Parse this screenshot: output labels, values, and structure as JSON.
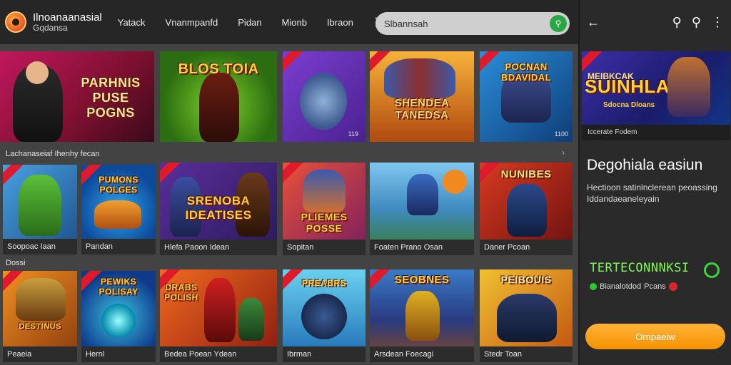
{
  "header": {
    "brand_title": "Ilnoanaanasial",
    "brand_subtitle": "Gqdansa",
    "nav": [
      "Yatack",
      "Vnanmpanfd",
      "Pidan",
      "Mionb",
      "Ibraon"
    ],
    "search_value": "Slbannsah"
  },
  "row1": [
    {
      "title": "PARHNIS\nPUSE POGNS"
    },
    {
      "title": "BLOS  TOIA"
    },
    {
      "title": "",
      "badge": "119"
    },
    {
      "title": "SHENDEA\nTANEDSA"
    },
    {
      "title": "POCNAN\nBDAVIDAL",
      "badge": "1100"
    }
  ],
  "section1_label": "Lachanaseiaf Ihenhy fecan",
  "row2": [
    {
      "title": "",
      "caption": "Soopoac Iaan"
    },
    {
      "title": "PUMONS\nPOLGES",
      "caption": "Pandan"
    },
    {
      "title": "SRENOBA\nIDEATISES",
      "caption": "Hlefa Paoon Idean"
    },
    {
      "title": "PLIEMES\nPOSSE",
      "caption": "Sopitan"
    },
    {
      "title": "",
      "caption": "Foaten Prano Osan"
    },
    {
      "title": "NUNIBES",
      "caption": "Daner Pcoan"
    }
  ],
  "section2_label": "Dossi",
  "row3": [
    {
      "title": "DESTINUS",
      "caption": "Peaeia"
    },
    {
      "title": "PEWIKS\nPOLISAY",
      "caption": "Hernl"
    },
    {
      "title": "DRABS\nPOLISH",
      "caption": "Bedea Poean Ydean"
    },
    {
      "title": "PREABRS",
      "caption": "Ibrman"
    },
    {
      "title": "SEOBNES",
      "caption": "Arsdean Foecagi"
    },
    {
      "title": "PEIBOUIS",
      "caption": "Stedr Toan"
    }
  ],
  "panel": {
    "feature_sub": "MEIBKCAK",
    "feature_title": "SUINHLAS",
    "feature_tag": "Sdocna Dloans",
    "feature_caption": "Iccerate Fodem",
    "title": "Degohiala easiun",
    "description": "Hectioon satinlnclerean peoassing Iddandaeaneleyain",
    "green_text": "TERTECONNNKSI",
    "meta_text": "Bianalotdod",
    "meta_text2": "Pcans",
    "cta": "Ornpaeiw"
  },
  "colors": {
    "accent": "#f59300",
    "brand_green": "#28a745",
    "ribbon": "#e0192b"
  }
}
